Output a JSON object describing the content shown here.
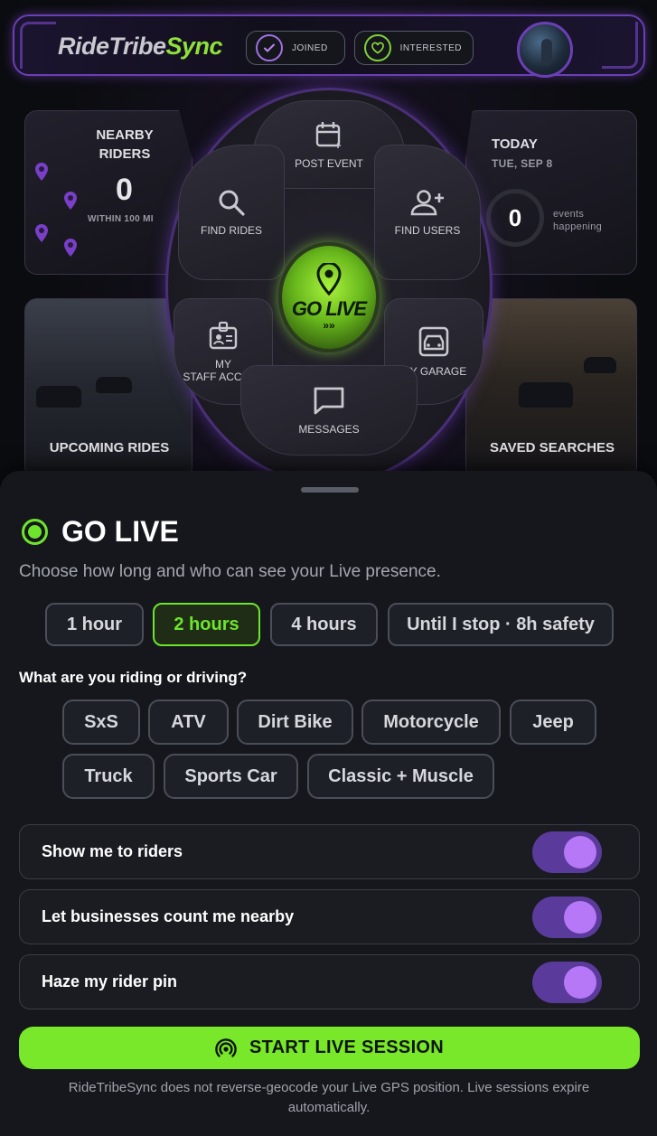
{
  "header": {
    "brand_part1": "RideTribe",
    "brand_part2": "Sync",
    "joined_label": "JOINED",
    "interested_label": "INTERESTED"
  },
  "dashboard": {
    "nearby": {
      "title_line1": "NEARBY",
      "title_line2": "RIDERS",
      "count": "0",
      "radius": "WITHIN 100 MI"
    },
    "today": {
      "title": "TODAY",
      "date": "TUE, SEP 8",
      "count": "0",
      "events_line1": "events",
      "events_line2": "happening"
    },
    "upcoming_label": "UPCOMING RIDES",
    "saved_label": "SAVED SEARCHES"
  },
  "radial_menu": {
    "post_event": "POST EVENT",
    "find_rides": "FIND RIDES",
    "find_users": "FIND USERS",
    "staff_line1": "MY",
    "staff_line2": "STAFF ACCESS",
    "garage": "MY GARAGE",
    "messages": "MESSAGES",
    "go_live": "GO LIVE"
  },
  "sheet": {
    "title": "GO LIVE",
    "subtitle": "Choose how long and who can see your Live presence.",
    "durations": [
      "1 hour",
      "2 hours",
      "4 hours",
      "Until I stop · 8h safety"
    ],
    "selected_duration": "2 hours",
    "vehicle_prompt": "What are you riding or driving?",
    "vehicles": [
      "SxS",
      "ATV",
      "Dirt Bike",
      "Motorcycle",
      "Jeep",
      "Truck",
      "Sports Car",
      "Classic + Muscle"
    ],
    "toggles": [
      {
        "label": "Show me to riders",
        "on": true
      },
      {
        "label": "Let businesses count me nearby",
        "on": true
      },
      {
        "label": "Haze my rider pin",
        "on": true
      }
    ],
    "start_button": "START LIVE SESSION",
    "footnote": "RideTribeSync does not reverse-geocode your Live GPS position. Live sessions expire automatically."
  },
  "colors": {
    "accent_green": "#79e82a",
    "accent_purple": "#6b3fb5",
    "toggle_on": "#b678f7"
  }
}
